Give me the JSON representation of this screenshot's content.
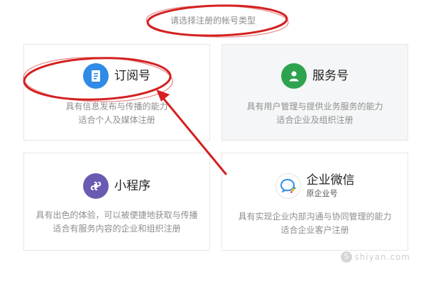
{
  "header": {
    "prompt": "请选择注册的帐号类型"
  },
  "cards": [
    {
      "title": "订阅号",
      "icon": "document-icon",
      "color": "#2f8be6",
      "desc": [
        "具有信息发布与传播的能力",
        "适合个人及媒体注册"
      ]
    },
    {
      "title": "服务号",
      "icon": "user-icon",
      "color": "#2ea34f",
      "desc": [
        "具有用户管理与提供业务服务的能力",
        "适合企业及组织注册"
      ]
    },
    {
      "title": "小程序",
      "icon": "mini-program-icon",
      "color": "#6b5ab2",
      "desc": [
        "具有出色的体验，可以被便捷地获取与传播",
        "适合有服务内容的企业和组织注册"
      ]
    },
    {
      "title": "企业微信",
      "subtitle": "原企业号",
      "icon": "wecom-icon",
      "color": "#2d8ee6",
      "desc": [
        "具有实现企业内部沟通与协同管理的能力",
        "适合企业客户注册"
      ]
    }
  ],
  "annotations": {
    "color": "#d42020"
  },
  "watermark": {
    "badge": "S",
    "text": "shiyan.com"
  }
}
